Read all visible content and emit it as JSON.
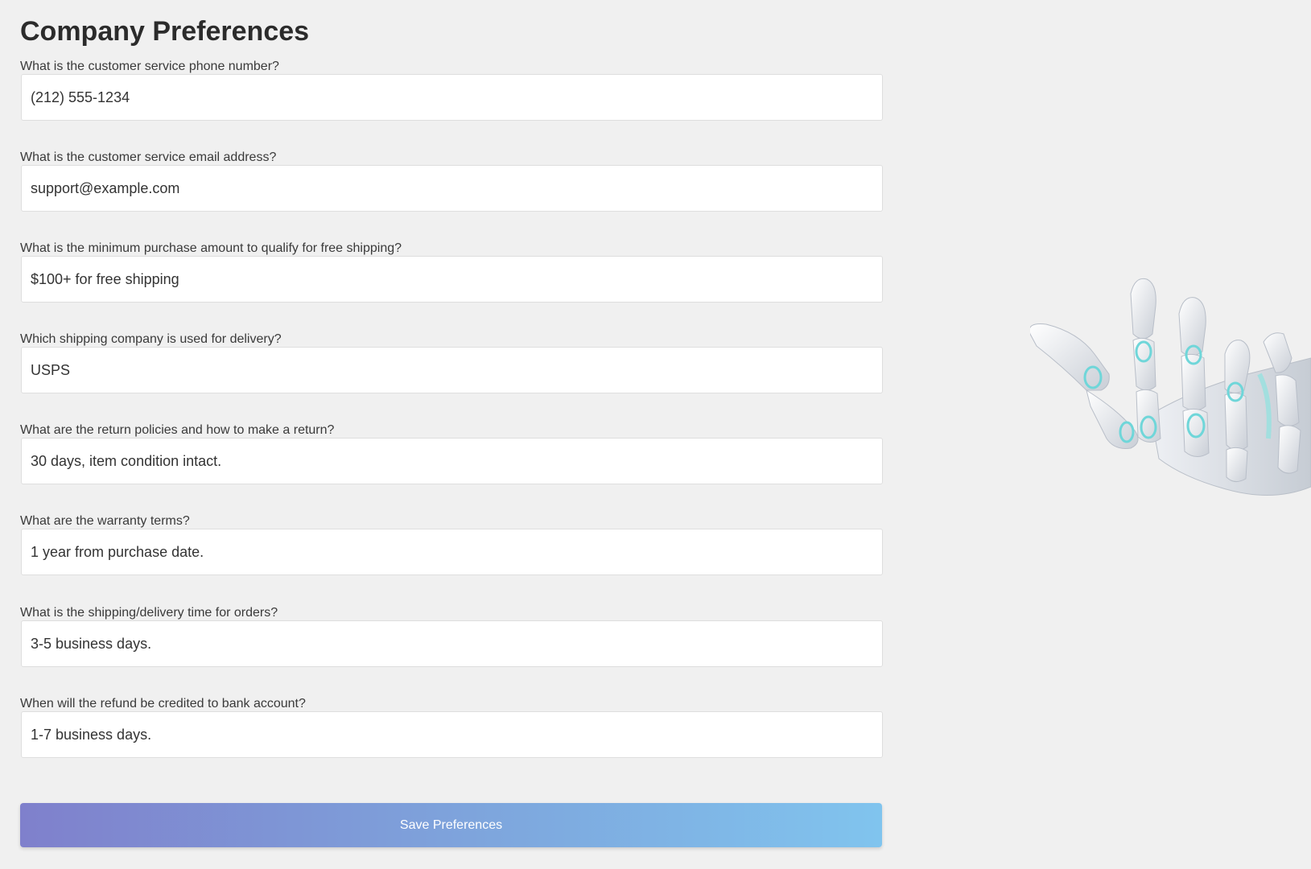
{
  "page": {
    "title": "Company Preferences"
  },
  "fields": [
    {
      "label": "What is the customer service phone number?",
      "value": "(212) 555-1234"
    },
    {
      "label": "What is the customer service email address?",
      "value": "support@example.com"
    },
    {
      "label": "What is the minimum purchase amount to qualify for free shipping?",
      "value": "$100+ for free shipping"
    },
    {
      "label": "Which shipping company is used for delivery?",
      "value": "USPS"
    },
    {
      "label": "What are the return policies and how to make a return?",
      "value": "30 days, item condition intact."
    },
    {
      "label": "What are the warranty terms?",
      "value": "1 year from purchase date."
    },
    {
      "label": "What is the shipping/delivery time for orders?",
      "value": "3-5 business days."
    },
    {
      "label": "When will the refund be credited to bank account?",
      "value": "1-7 business days."
    }
  ],
  "actions": {
    "save_label": "Save Preferences"
  },
  "colors": {
    "background": "#f0f0f0",
    "button_gradient_start": "#7f80cc",
    "button_gradient_end": "#80c4ee"
  },
  "illustration": {
    "icon": "robot-hand-icon"
  }
}
